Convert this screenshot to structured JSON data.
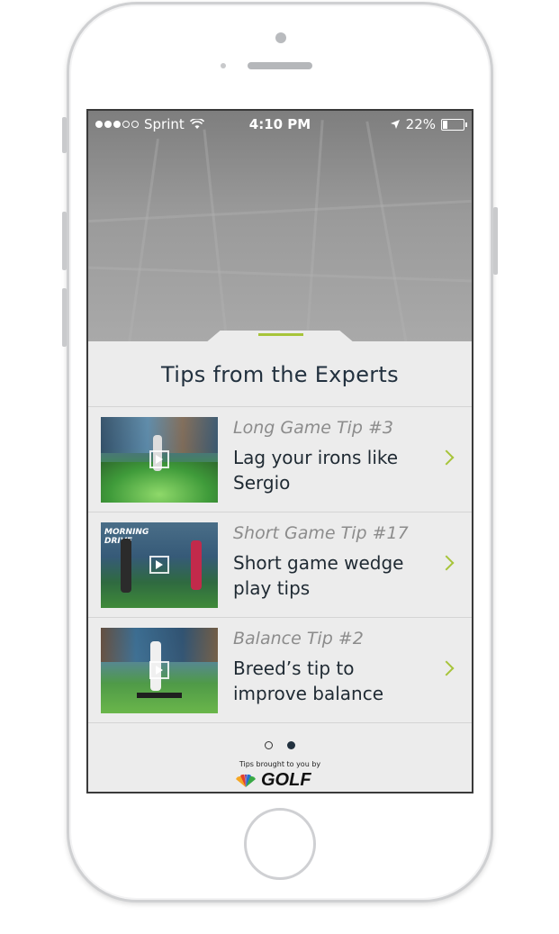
{
  "status_bar": {
    "carrier": "Sprint",
    "time": "4:10 PM",
    "battery": "22%",
    "battery_level": 0.22,
    "signal_bars_filled": 3,
    "signal_bars_total": 5
  },
  "panel": {
    "title": "Tips from the Experts"
  },
  "tips": [
    {
      "category": "Long Game Tip #3",
      "title": "Lag your irons like Sergio",
      "thumb_icon": "play-icon"
    },
    {
      "category": "Short Game Tip #17",
      "title": "Short game wedge play tips",
      "thumb_icon": "play-icon",
      "thumb_text": "MORNING DRIVE"
    },
    {
      "category": "Balance Tip #2",
      "title": "Breed’s tip to improve balance",
      "thumb_icon": "play-icon"
    }
  ],
  "pager": {
    "pages": 2,
    "active_index": 1
  },
  "footer": {
    "credit": "Tips brought to you by",
    "brand": "GOLF"
  },
  "colors": {
    "accent": "#a7c43a",
    "title": "#22313f",
    "category": "#8c8c8c"
  }
}
